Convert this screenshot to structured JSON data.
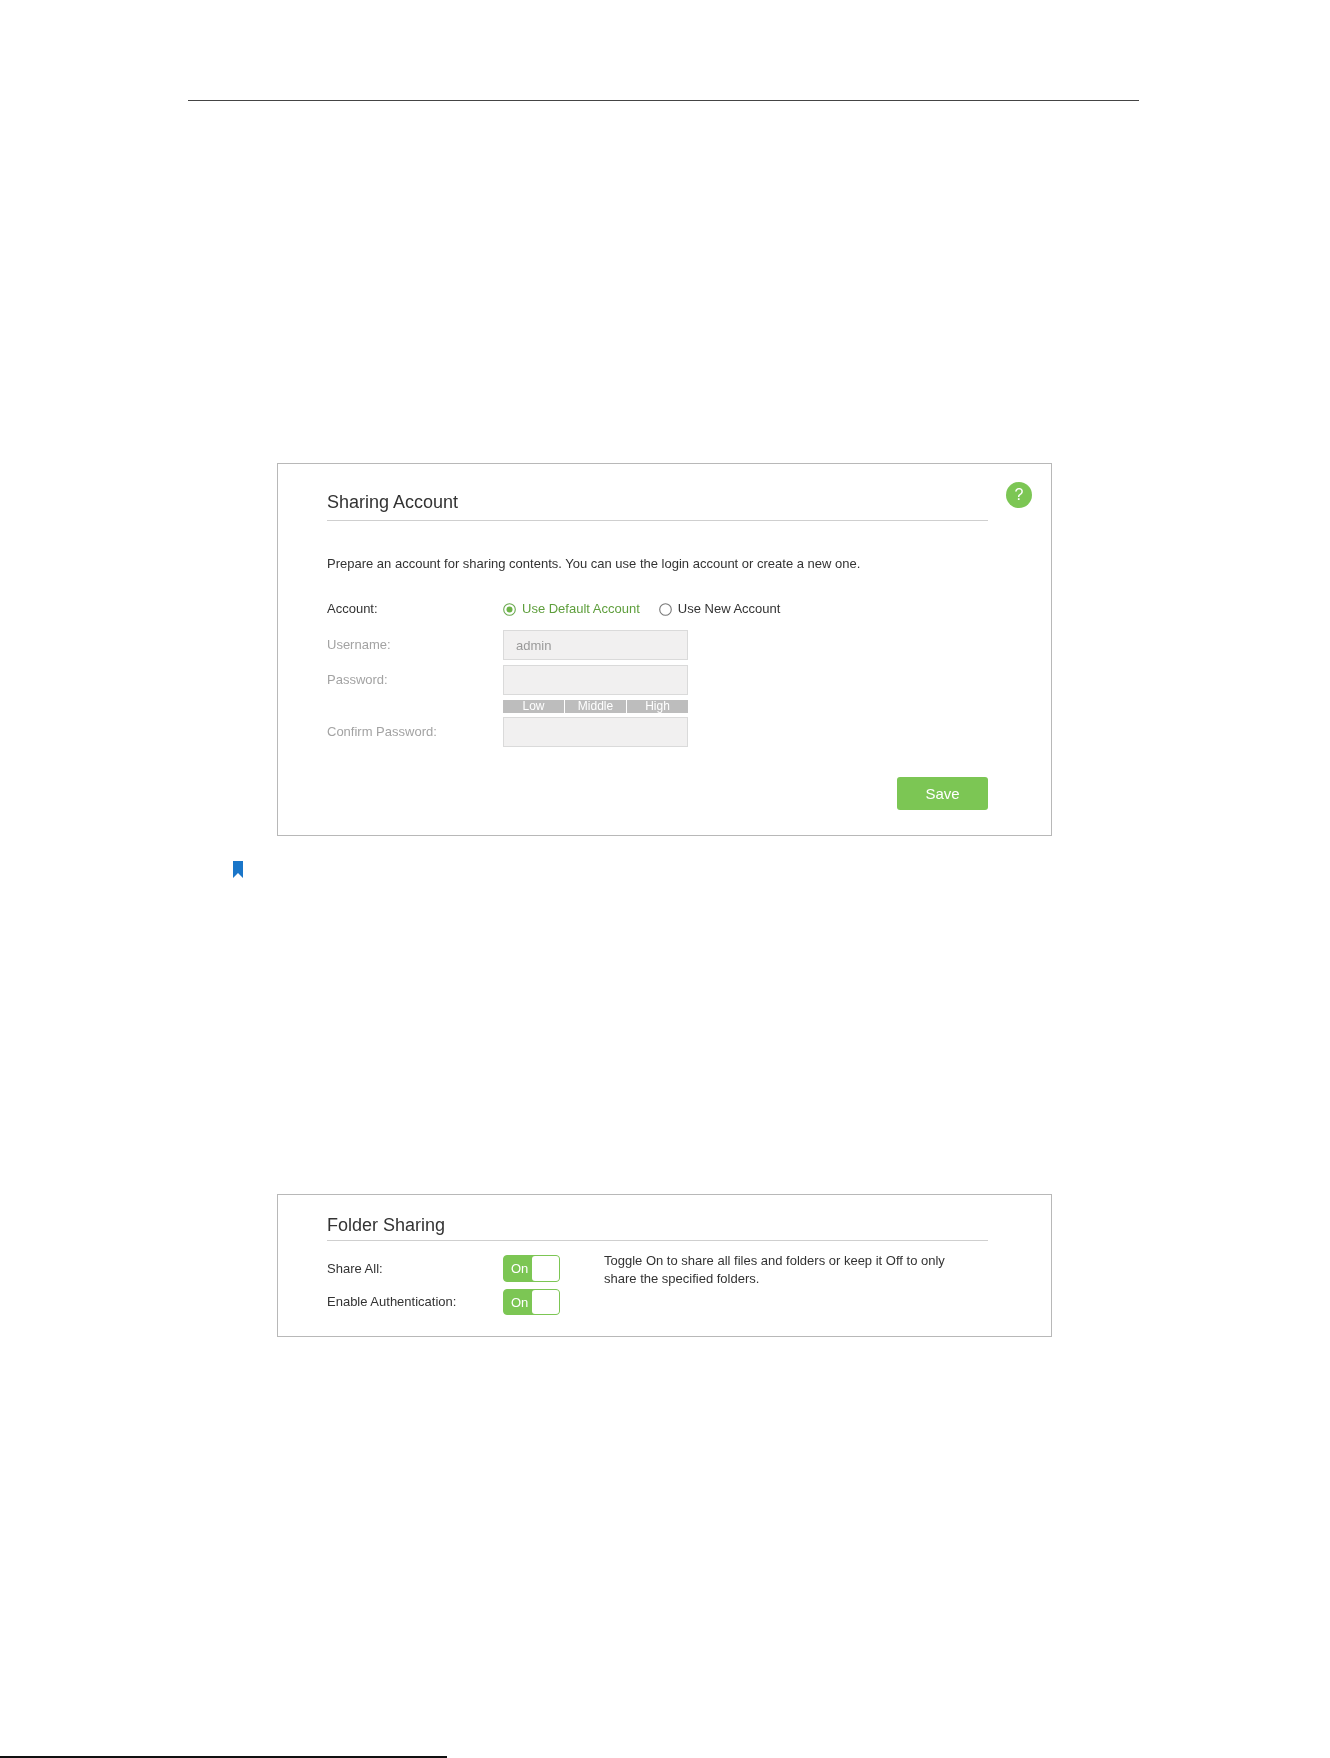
{
  "sharing_account": {
    "title": "Sharing Account",
    "help": "?",
    "description": "Prepare an account for sharing contents. You can use the login account or create a new one.",
    "account": {
      "label": "Account:",
      "options": [
        {
          "label": "Use Default Account",
          "selected": true
        },
        {
          "label": "Use New Account",
          "selected": false
        }
      ]
    },
    "fields": [
      {
        "label": "Username:",
        "value": "admin",
        "disabled": true
      },
      {
        "label": "Password:",
        "disabled": true,
        "strength_labels": [
          "Low",
          "Middle",
          "High"
        ]
      },
      {
        "label": "Confirm Password:",
        "disabled": true
      }
    ],
    "save_button": "Save"
  },
  "folder_sharing": {
    "title": "Folder Sharing",
    "toggles": [
      {
        "label": "Share All:",
        "on": true,
        "text": "On"
      },
      {
        "label": "Enable Authentication:",
        "on": true,
        "text": "On"
      }
    ],
    "note": "Toggle On to share all files and folders or keep it Off to only share the specified folders."
  }
}
